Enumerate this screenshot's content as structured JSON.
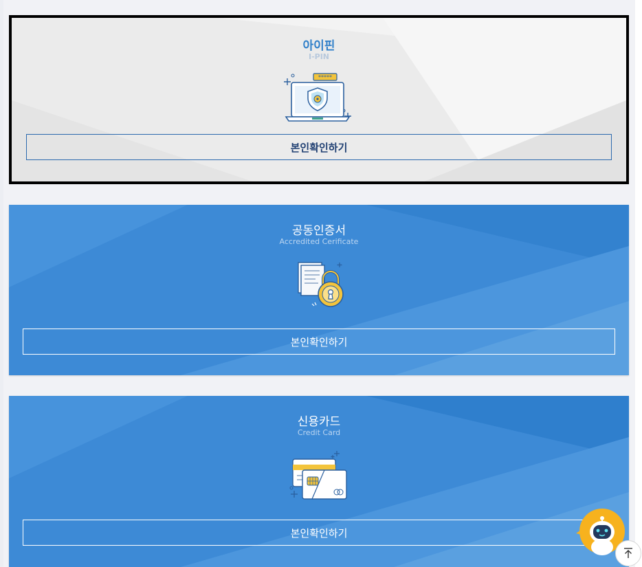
{
  "cards": [
    {
      "id": "ipin",
      "title": "아이핀",
      "subtitle": "I-PIN",
      "button_label": "본인확인하기",
      "icon": "laptop-shield-icon"
    },
    {
      "id": "certificate",
      "title": "공동인증서",
      "subtitle": "Accredited Cerificate",
      "button_label": "본인확인하기",
      "icon": "document-lock-icon"
    },
    {
      "id": "credit-card",
      "title": "신용카드",
      "subtitle": "Credit Card",
      "button_label": "본인확인하기",
      "icon": "credit-card-icon"
    }
  ],
  "ipin_password_mask": "*****",
  "floating": {
    "chatbot_icon": "chatbot-robot-icon",
    "top_icon": "scroll-to-top-icon"
  },
  "colors": {
    "ipin_title": "#2f7fc9",
    "card_blue": "#3d8ad6",
    "ipin_border": "#000000",
    "accent_yellow": "#f3c43b"
  }
}
